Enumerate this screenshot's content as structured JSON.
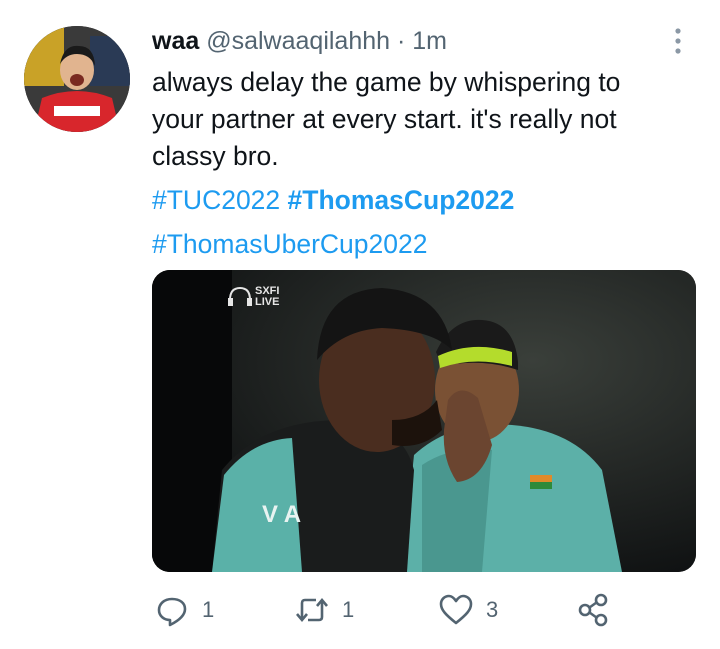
{
  "tweet": {
    "author_name": "waa",
    "handle": "@salwaaqilahhh",
    "separator": "·",
    "time": "1m",
    "text_lines": [
      "always delay the game by whispering to",
      "your partner at every start. it's really not",
      "classy bro."
    ],
    "hashtags": {
      "tag1": "#TUC2022",
      "tag2": "#ThomasCup2022",
      "tag3": "#ThomasUberCup2022"
    },
    "media": {
      "watermark_top": "SXFI",
      "watermark_bottom": "LIVE",
      "jersey_text": "V  A"
    }
  },
  "actions": {
    "reply_count": "1",
    "retweet_count": "1",
    "like_count": "3"
  },
  "icons": {
    "more": "more-vertical-icon",
    "reply": "reply-icon",
    "retweet": "retweet-icon",
    "like": "heart-icon",
    "share": "share-icon"
  },
  "colors": {
    "link": "#1d9bf0",
    "secondary": "#536471",
    "text": "#0f1419"
  }
}
